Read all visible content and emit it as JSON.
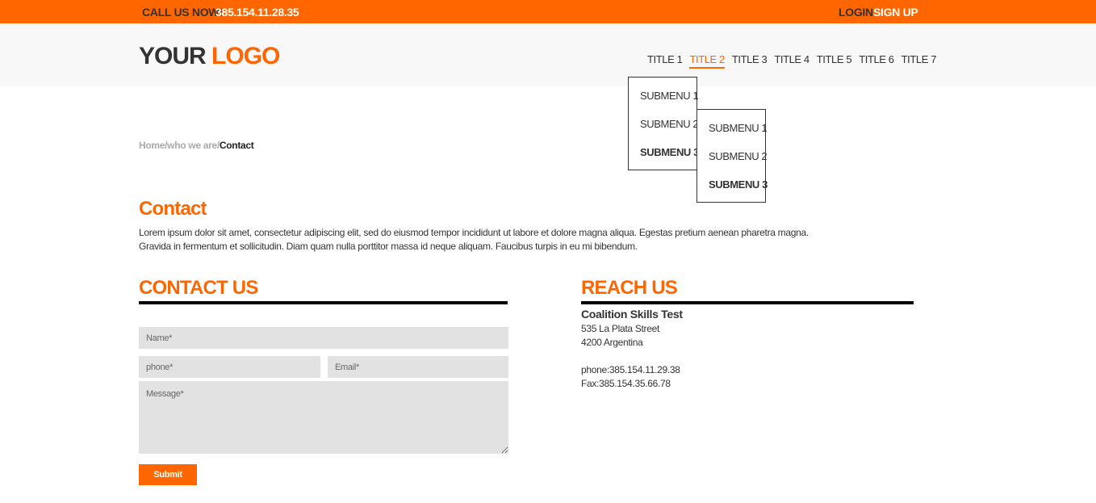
{
  "topbar": {
    "call_label": "CALL US NOW!",
    "phone": "385.154.11.28.35",
    "login": "LOGIN",
    "signup": "SIGN UP"
  },
  "header": {
    "logo_part1": "YOUR",
    "logo_part2": "LOGO",
    "nav": [
      "TITLE 1",
      "TITLE 2",
      "TITLE 3",
      "TITLE 4",
      "TITLE 5",
      "TITLE 6",
      "TITLE 7"
    ],
    "active_nav": "TITLE 2"
  },
  "dropdowns": {
    "primary": [
      "SUBMENU 1",
      "SUBMENU 2",
      "SUBMENU 3"
    ],
    "secondary": [
      "SUBMENU 1",
      "SUBMENU 2",
      "SUBMENU 3"
    ]
  },
  "breadcrumb": {
    "path": "Home/who we are/",
    "current": "Contact"
  },
  "intro": {
    "title": "Contact",
    "line1": "Lorem ipsum dolor sit amet, consectetur adipiscing elit, sed do eiusmod tempor incididunt ut labore et dolore magna aliqua. Egestas pretium aenean pharetra magna.",
    "line2": "Gravida in fermentum et sollicitudin. Diam quam nulla porttitor massa id neque aliquam. Faucibus turpis in eu mi bibendum."
  },
  "contact_form": {
    "title": "CONTACT US",
    "name_placeholder": "Name*",
    "phone_placeholder": "phone*",
    "email_placeholder": "Email*",
    "message_placeholder": "Message*",
    "submit_label": "Submit"
  },
  "reach": {
    "title": "REACH US",
    "org": "Coalition Skills Test",
    "street": "535 La Plata Street",
    "city": "4200 Argentina",
    "phone": "phone:385.154.11.29.38",
    "fax": "Fax:385.154.35.66.78"
  },
  "colors": {
    "accent": "#ff6600",
    "text": "#333333",
    "field_bg": "#e3e2e3",
    "header_bg": "#f8f8f8"
  }
}
